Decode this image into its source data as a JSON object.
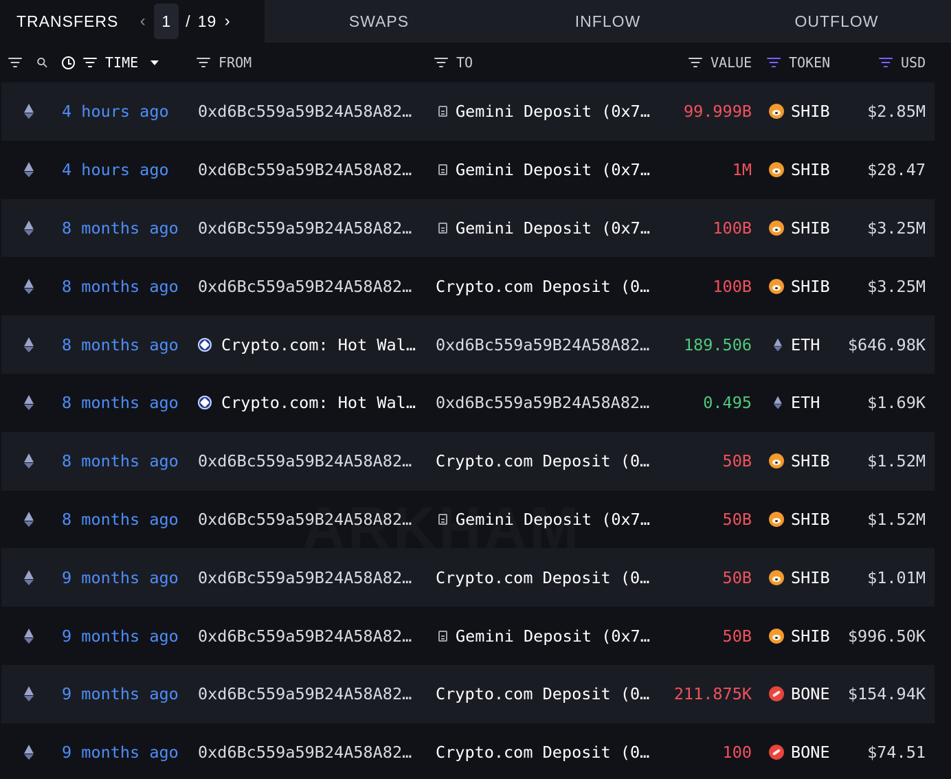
{
  "tabs": {
    "transfers": "TRANSFERS",
    "swaps": "SWAPS",
    "inflow": "INFLOW",
    "outflow": "OUTFLOW"
  },
  "pagination": {
    "current": "1",
    "separator": "/",
    "total": "19"
  },
  "columns": {
    "time": "TIME",
    "from": "FROM",
    "to": "TO",
    "value": "VALUE",
    "token": "TOKEN",
    "usd": "USD"
  },
  "watermark": "ARKHAM",
  "rows": [
    {
      "time": "4 hours ago",
      "from": "0xd6Bc559a59B24A58A82…",
      "from_icon": "",
      "to": "Gemini Deposit (0x7…",
      "to_icon": "doc",
      "value": "99.999B",
      "value_dir": "neg",
      "token": "SHIB",
      "token_icon": "shib",
      "usd": "$2.85M"
    },
    {
      "time": "4 hours ago",
      "from": "0xd6Bc559a59B24A58A82…",
      "from_icon": "",
      "to": "Gemini Deposit (0x7…",
      "to_icon": "doc",
      "value": "1M",
      "value_dir": "neg",
      "token": "SHIB",
      "token_icon": "shib",
      "usd": "$28.47"
    },
    {
      "time": "8 months ago",
      "from": "0xd6Bc559a59B24A58A82…",
      "from_icon": "",
      "to": "Gemini Deposit (0x7…",
      "to_icon": "doc",
      "value": "100B",
      "value_dir": "neg",
      "token": "SHIB",
      "token_icon": "shib",
      "usd": "$3.25M"
    },
    {
      "time": "8 months ago",
      "from": "0xd6Bc559a59B24A58A82…",
      "from_icon": "",
      "to": "Crypto.com Deposit (0…",
      "to_icon": "",
      "value": "100B",
      "value_dir": "neg",
      "token": "SHIB",
      "token_icon": "shib",
      "usd": "$3.25M"
    },
    {
      "time": "8 months ago",
      "from": "Crypto.com: Hot Wal…",
      "from_icon": "cro",
      "to": "0xd6Bc559a59B24A58A82…",
      "to_icon": "",
      "value": "189.506",
      "value_dir": "pos",
      "token": "ETH",
      "token_icon": "eth",
      "usd": "$646.98K"
    },
    {
      "time": "8 months ago",
      "from": "Crypto.com: Hot Wal…",
      "from_icon": "cro",
      "to": "0xd6Bc559a59B24A58A82…",
      "to_icon": "",
      "value": "0.495",
      "value_dir": "pos",
      "token": "ETH",
      "token_icon": "eth",
      "usd": "$1.69K"
    },
    {
      "time": "8 months ago",
      "from": "0xd6Bc559a59B24A58A82…",
      "from_icon": "",
      "to": "Crypto.com Deposit (0…",
      "to_icon": "",
      "value": "50B",
      "value_dir": "neg",
      "token": "SHIB",
      "token_icon": "shib",
      "usd": "$1.52M"
    },
    {
      "time": "8 months ago",
      "from": "0xd6Bc559a59B24A58A82…",
      "from_icon": "",
      "to": "Gemini Deposit (0x7…",
      "to_icon": "doc",
      "value": "50B",
      "value_dir": "neg",
      "token": "SHIB",
      "token_icon": "shib",
      "usd": "$1.52M"
    },
    {
      "time": "9 months ago",
      "from": "0xd6Bc559a59B24A58A82…",
      "from_icon": "",
      "to": "Crypto.com Deposit (0…",
      "to_icon": "",
      "value": "50B",
      "value_dir": "neg",
      "token": "SHIB",
      "token_icon": "shib",
      "usd": "$1.01M"
    },
    {
      "time": "9 months ago",
      "from": "0xd6Bc559a59B24A58A82…",
      "from_icon": "",
      "to": "Gemini Deposit (0x7…",
      "to_icon": "doc",
      "value": "50B",
      "value_dir": "neg",
      "token": "SHIB",
      "token_icon": "shib",
      "usd": "$996.50K"
    },
    {
      "time": "9 months ago",
      "from": "0xd6Bc559a59B24A58A82…",
      "from_icon": "",
      "to": "Crypto.com Deposit (0…",
      "to_icon": "",
      "value": "211.875K",
      "value_dir": "neg",
      "token": "BONE",
      "token_icon": "bone",
      "usd": "$154.94K"
    },
    {
      "time": "9 months ago",
      "from": "0xd6Bc559a59B24A58A82…",
      "from_icon": "",
      "to": "Crypto.com Deposit (0…",
      "to_icon": "",
      "value": "100",
      "value_dir": "neg",
      "token": "BONE",
      "token_icon": "bone",
      "usd": "$74.51"
    }
  ],
  "colors": {
    "background": "#111218",
    "row_alt": "#1a1c24",
    "time_link": "#4d8ef7",
    "value_out": "#f0525c",
    "value_in": "#4fc97c",
    "accent_filter": "#7b61ff"
  }
}
